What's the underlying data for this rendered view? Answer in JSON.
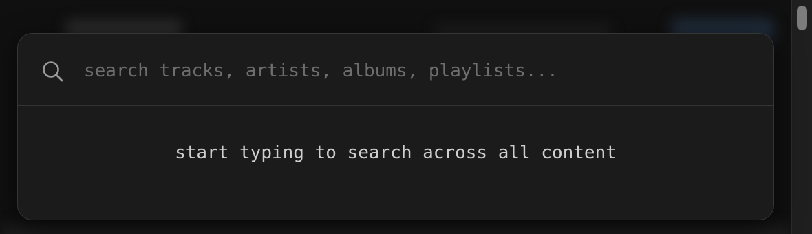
{
  "search": {
    "icon": "search-icon",
    "placeholder": "search tracks, artists, albums, playlists...",
    "value": "",
    "empty_hint": "start typing to search across all content"
  },
  "colors": {
    "modal_background": "#1b1b1b",
    "modal_border": "#363636",
    "placeholder_text": "#6e6e6e",
    "hint_text": "#cfcfcf",
    "scrollbar_thumb": "#7c7c7c"
  }
}
